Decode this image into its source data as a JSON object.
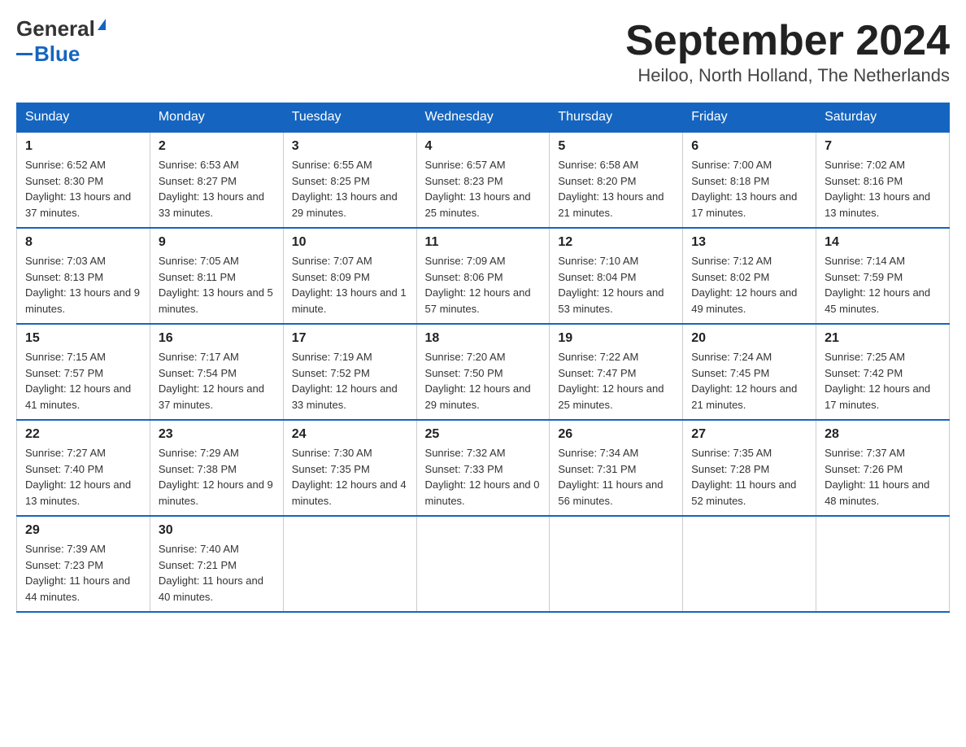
{
  "header": {
    "logo_general": "General",
    "logo_blue": "Blue",
    "month_title": "September 2024",
    "location": "Heiloo, North Holland, The Netherlands"
  },
  "days_of_week": [
    "Sunday",
    "Monday",
    "Tuesday",
    "Wednesday",
    "Thursday",
    "Friday",
    "Saturday"
  ],
  "weeks": [
    [
      {
        "day": "1",
        "sunrise": "Sunrise: 6:52 AM",
        "sunset": "Sunset: 8:30 PM",
        "daylight": "Daylight: 13 hours and 37 minutes."
      },
      {
        "day": "2",
        "sunrise": "Sunrise: 6:53 AM",
        "sunset": "Sunset: 8:27 PM",
        "daylight": "Daylight: 13 hours and 33 minutes."
      },
      {
        "day": "3",
        "sunrise": "Sunrise: 6:55 AM",
        "sunset": "Sunset: 8:25 PM",
        "daylight": "Daylight: 13 hours and 29 minutes."
      },
      {
        "day": "4",
        "sunrise": "Sunrise: 6:57 AM",
        "sunset": "Sunset: 8:23 PM",
        "daylight": "Daylight: 13 hours and 25 minutes."
      },
      {
        "day": "5",
        "sunrise": "Sunrise: 6:58 AM",
        "sunset": "Sunset: 8:20 PM",
        "daylight": "Daylight: 13 hours and 21 minutes."
      },
      {
        "day": "6",
        "sunrise": "Sunrise: 7:00 AM",
        "sunset": "Sunset: 8:18 PM",
        "daylight": "Daylight: 13 hours and 17 minutes."
      },
      {
        "day": "7",
        "sunrise": "Sunrise: 7:02 AM",
        "sunset": "Sunset: 8:16 PM",
        "daylight": "Daylight: 13 hours and 13 minutes."
      }
    ],
    [
      {
        "day": "8",
        "sunrise": "Sunrise: 7:03 AM",
        "sunset": "Sunset: 8:13 PM",
        "daylight": "Daylight: 13 hours and 9 minutes."
      },
      {
        "day": "9",
        "sunrise": "Sunrise: 7:05 AM",
        "sunset": "Sunset: 8:11 PM",
        "daylight": "Daylight: 13 hours and 5 minutes."
      },
      {
        "day": "10",
        "sunrise": "Sunrise: 7:07 AM",
        "sunset": "Sunset: 8:09 PM",
        "daylight": "Daylight: 13 hours and 1 minute."
      },
      {
        "day": "11",
        "sunrise": "Sunrise: 7:09 AM",
        "sunset": "Sunset: 8:06 PM",
        "daylight": "Daylight: 12 hours and 57 minutes."
      },
      {
        "day": "12",
        "sunrise": "Sunrise: 7:10 AM",
        "sunset": "Sunset: 8:04 PM",
        "daylight": "Daylight: 12 hours and 53 minutes."
      },
      {
        "day": "13",
        "sunrise": "Sunrise: 7:12 AM",
        "sunset": "Sunset: 8:02 PM",
        "daylight": "Daylight: 12 hours and 49 minutes."
      },
      {
        "day": "14",
        "sunrise": "Sunrise: 7:14 AM",
        "sunset": "Sunset: 7:59 PM",
        "daylight": "Daylight: 12 hours and 45 minutes."
      }
    ],
    [
      {
        "day": "15",
        "sunrise": "Sunrise: 7:15 AM",
        "sunset": "Sunset: 7:57 PM",
        "daylight": "Daylight: 12 hours and 41 minutes."
      },
      {
        "day": "16",
        "sunrise": "Sunrise: 7:17 AM",
        "sunset": "Sunset: 7:54 PM",
        "daylight": "Daylight: 12 hours and 37 minutes."
      },
      {
        "day": "17",
        "sunrise": "Sunrise: 7:19 AM",
        "sunset": "Sunset: 7:52 PM",
        "daylight": "Daylight: 12 hours and 33 minutes."
      },
      {
        "day": "18",
        "sunrise": "Sunrise: 7:20 AM",
        "sunset": "Sunset: 7:50 PM",
        "daylight": "Daylight: 12 hours and 29 minutes."
      },
      {
        "day": "19",
        "sunrise": "Sunrise: 7:22 AM",
        "sunset": "Sunset: 7:47 PM",
        "daylight": "Daylight: 12 hours and 25 minutes."
      },
      {
        "day": "20",
        "sunrise": "Sunrise: 7:24 AM",
        "sunset": "Sunset: 7:45 PM",
        "daylight": "Daylight: 12 hours and 21 minutes."
      },
      {
        "day": "21",
        "sunrise": "Sunrise: 7:25 AM",
        "sunset": "Sunset: 7:42 PM",
        "daylight": "Daylight: 12 hours and 17 minutes."
      }
    ],
    [
      {
        "day": "22",
        "sunrise": "Sunrise: 7:27 AM",
        "sunset": "Sunset: 7:40 PM",
        "daylight": "Daylight: 12 hours and 13 minutes."
      },
      {
        "day": "23",
        "sunrise": "Sunrise: 7:29 AM",
        "sunset": "Sunset: 7:38 PM",
        "daylight": "Daylight: 12 hours and 9 minutes."
      },
      {
        "day": "24",
        "sunrise": "Sunrise: 7:30 AM",
        "sunset": "Sunset: 7:35 PM",
        "daylight": "Daylight: 12 hours and 4 minutes."
      },
      {
        "day": "25",
        "sunrise": "Sunrise: 7:32 AM",
        "sunset": "Sunset: 7:33 PM",
        "daylight": "Daylight: 12 hours and 0 minutes."
      },
      {
        "day": "26",
        "sunrise": "Sunrise: 7:34 AM",
        "sunset": "Sunset: 7:31 PM",
        "daylight": "Daylight: 11 hours and 56 minutes."
      },
      {
        "day": "27",
        "sunrise": "Sunrise: 7:35 AM",
        "sunset": "Sunset: 7:28 PM",
        "daylight": "Daylight: 11 hours and 52 minutes."
      },
      {
        "day": "28",
        "sunrise": "Sunrise: 7:37 AM",
        "sunset": "Sunset: 7:26 PM",
        "daylight": "Daylight: 11 hours and 48 minutes."
      }
    ],
    [
      {
        "day": "29",
        "sunrise": "Sunrise: 7:39 AM",
        "sunset": "Sunset: 7:23 PM",
        "daylight": "Daylight: 11 hours and 44 minutes."
      },
      {
        "day": "30",
        "sunrise": "Sunrise: 7:40 AM",
        "sunset": "Sunset: 7:21 PM",
        "daylight": "Daylight: 11 hours and 40 minutes."
      },
      null,
      null,
      null,
      null,
      null
    ]
  ]
}
